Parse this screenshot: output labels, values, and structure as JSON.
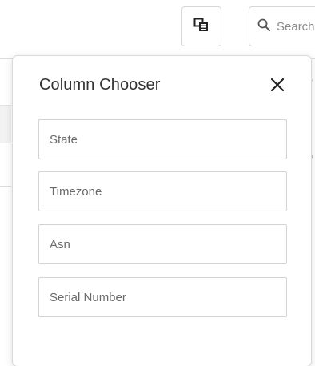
{
  "toolbar": {
    "column_chooser_icon": "column-chooser-icon",
    "search_icon": "search-icon",
    "search_placeholder": "Search"
  },
  "popup": {
    "title": "Column Chooser",
    "close_icon": "close-icon",
    "fields": [
      {
        "label": "State"
      },
      {
        "label": "Timezone"
      },
      {
        "label": "Asn"
      },
      {
        "label": "Serial Number"
      }
    ]
  }
}
